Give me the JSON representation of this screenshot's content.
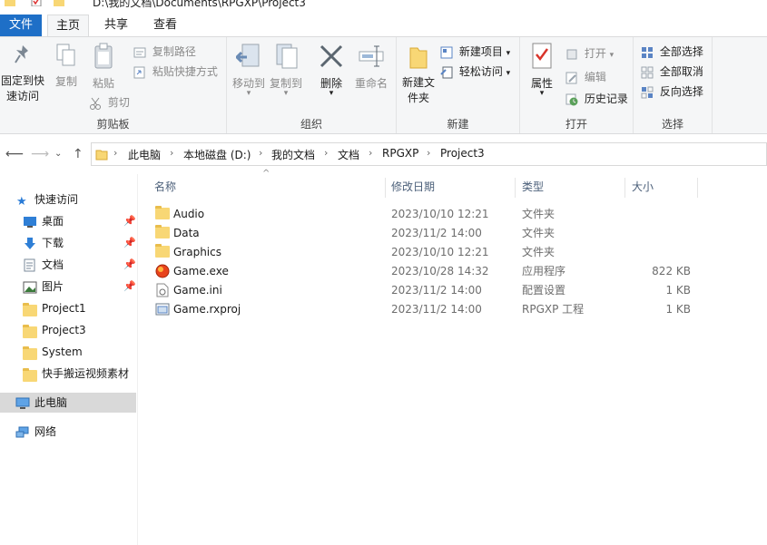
{
  "window": {
    "path": "D:\\我的文档\\Documents\\RPGXP\\Project3"
  },
  "ribbon_tabs": {
    "file": "文件",
    "home": "主页",
    "share": "共享",
    "view": "查看"
  },
  "clipboard": {
    "pin": "固定到快速访问",
    "copy": "复制",
    "paste": "粘贴",
    "copy_path": "复制路径",
    "paste_shortcut": "粘贴快捷方式",
    "cut": "剪切",
    "label": "剪贴板"
  },
  "organize": {
    "move_to": "移动到",
    "copy_to": "复制到",
    "delete": "删除",
    "rename": "重命名",
    "label": "组织"
  },
  "new": {
    "new_folder": "新建文件夹",
    "new_item": "新建项目",
    "easy_access": "轻松访问",
    "label": "新建"
  },
  "open": {
    "properties": "属性",
    "open": "打开",
    "edit": "编辑",
    "history": "历史记录",
    "label": "打开"
  },
  "select": {
    "select_all": "全部选择",
    "select_none": "全部取消",
    "invert": "反向选择",
    "label": "选择"
  },
  "breadcrumbs": [
    "此电脑",
    "本地磁盘 (D:)",
    "我的文档",
    "文档",
    "RPGXP",
    "Project3"
  ],
  "nav": {
    "quick_access": "快速访问",
    "items": [
      {
        "label": "桌面",
        "pinned": true
      },
      {
        "label": "下载",
        "pinned": true
      },
      {
        "label": "文档",
        "pinned": true
      },
      {
        "label": "图片",
        "pinned": true
      },
      {
        "label": "Project1",
        "pinned": false
      },
      {
        "label": "Project3",
        "pinned": false
      },
      {
        "label": "System",
        "pinned": false
      },
      {
        "label": "快手搬运视频素材",
        "pinned": false
      }
    ],
    "this_pc": "此电脑",
    "network": "网络"
  },
  "columns": {
    "name": "名称",
    "date": "修改日期",
    "type": "类型",
    "size": "大小"
  },
  "files": [
    {
      "name": "Audio",
      "date": "2023/10/10 12:21",
      "type": "文件夹",
      "size": "",
      "icon": "folder-icon"
    },
    {
      "name": "Data",
      "date": "2023/11/2 14:00",
      "type": "文件夹",
      "size": "",
      "icon": "folder-icon"
    },
    {
      "name": "Graphics",
      "date": "2023/10/10 12:21",
      "type": "文件夹",
      "size": "",
      "icon": "folder-icon"
    },
    {
      "name": "Game.exe",
      "date": "2023/10/28 14:32",
      "type": "应用程序",
      "size": "822 KB",
      "icon": "exe-icon"
    },
    {
      "name": "Game.ini",
      "date": "2023/11/2 14:00",
      "type": "配置设置",
      "size": "1 KB",
      "icon": "ini-file-icon"
    },
    {
      "name": "Game.rxproj",
      "date": "2023/11/2 14:00",
      "type": "RPGXP 工程",
      "size": "1 KB",
      "icon": "project-file-icon"
    }
  ]
}
